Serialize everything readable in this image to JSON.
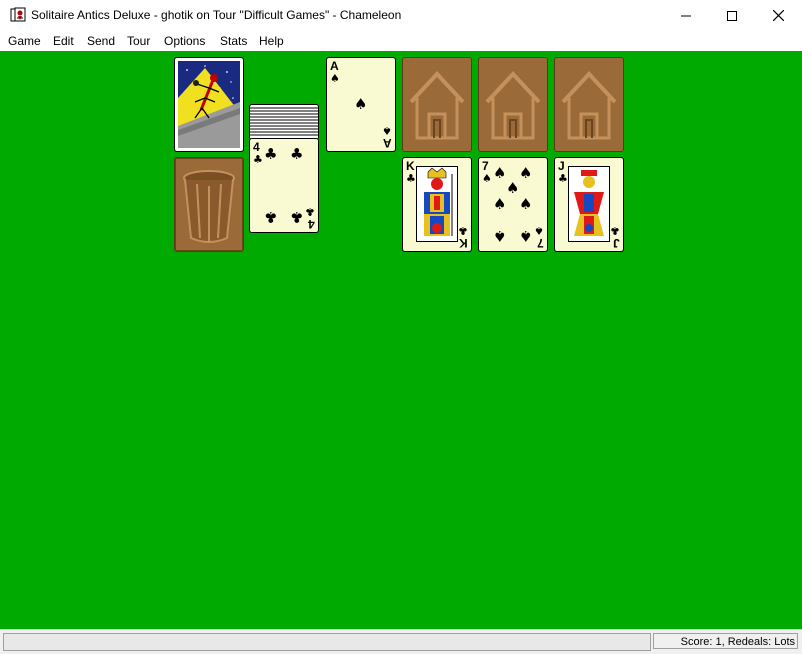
{
  "window": {
    "title": "Solitaire Antics Deluxe - ghotik on Tour \"Difficult Games\" - Chameleon"
  },
  "menu": {
    "items": [
      "Game",
      "Edit",
      "Send",
      "Tour",
      "Options",
      "Stats",
      "Help"
    ]
  },
  "table": {
    "felt_color": "#00aa00",
    "stock": {
      "state": "face-down",
      "back_design": "ant-climbing-icon"
    },
    "discard_pile": {
      "icon": "trash-can-icon"
    },
    "waste": {
      "top_rank": "4",
      "top_suit": "♣"
    },
    "reserve": {
      "rank": "A",
      "suit": "♠"
    },
    "foundations": [
      {
        "state": "empty",
        "icon": "house-icon"
      },
      {
        "state": "empty",
        "icon": "house-icon"
      },
      {
        "state": "empty",
        "icon": "house-icon"
      }
    ],
    "tableau": [
      {
        "rank": "K",
        "suit": "♣"
      },
      {
        "rank": "7",
        "suit": "♠"
      },
      {
        "rank": "J",
        "suit": "♣"
      }
    ]
  },
  "status": {
    "left_text": "",
    "score_text": "Score: 1, Redeals: Lots"
  }
}
